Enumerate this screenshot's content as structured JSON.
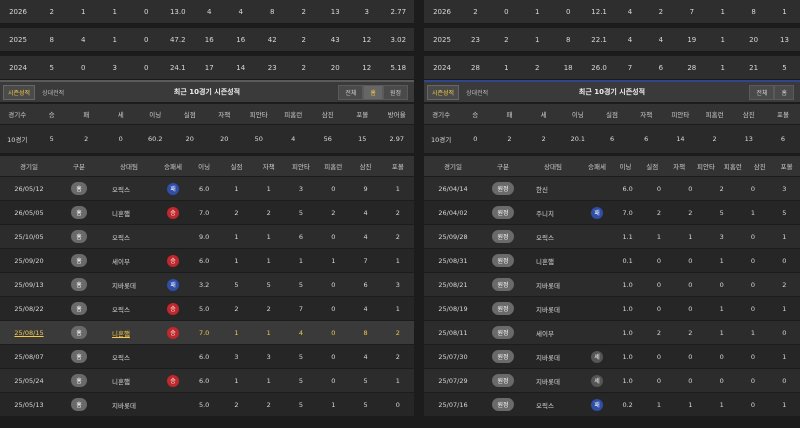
{
  "left": {
    "season_rows": [
      {
        "year": "2026",
        "vals": [
          "2",
          "1",
          "1",
          "0",
          "13.0",
          "4",
          "4",
          "8",
          "2",
          "13",
          "3",
          "2.77"
        ]
      },
      {
        "year": "2025",
        "vals": [
          "8",
          "4",
          "1",
          "0",
          "47.2",
          "16",
          "16",
          "42",
          "2",
          "43",
          "12",
          "3.02"
        ]
      },
      {
        "year": "2024",
        "vals": [
          "5",
          "0",
          "3",
          "0",
          "24.1",
          "17",
          "14",
          "23",
          "2",
          "20",
          "12",
          "5.18"
        ]
      }
    ],
    "tabs": [
      "시즌성적",
      "상대전적"
    ],
    "title": "최근 10경기 시즌성적",
    "filters": [
      "전체",
      "홈",
      "원정"
    ],
    "summary_headers": [
      "경기수",
      "승",
      "패",
      "세",
      "이닝",
      "실점",
      "자책",
      "피안타",
      "피홈런",
      "삼진",
      "포볼",
      "방어율"
    ],
    "summary_values": [
      "10경기",
      "5",
      "2",
      "0",
      "60.2",
      "20",
      "20",
      "50",
      "4",
      "56",
      "15",
      "2.97"
    ],
    "gamelog_headers": [
      "경기일",
      "구분",
      "상대팀",
      "승패세",
      "이닝",
      "실점",
      "자책",
      "피안타",
      "피홈런",
      "삼진",
      "포볼"
    ],
    "games": [
      {
        "date": "26/05/12",
        "ha": "홈",
        "opp": "오릭스",
        "dec": "패",
        "dec_type": "L",
        "nums": [
          "6.0",
          "1",
          "1",
          "3",
          "0",
          "9",
          "1"
        ]
      },
      {
        "date": "26/05/05",
        "ha": "홈",
        "opp": "니혼햄",
        "dec": "승",
        "dec_type": "W",
        "nums": [
          "7.0",
          "2",
          "2",
          "5",
          "2",
          "4",
          "2"
        ]
      },
      {
        "date": "25/10/05",
        "ha": "홈",
        "opp": "오릭스",
        "dec": "",
        "dec_type": "",
        "nums": [
          "9.0",
          "1",
          "1",
          "6",
          "0",
          "4",
          "2"
        ]
      },
      {
        "date": "25/09/20",
        "ha": "홈",
        "opp": "세이부",
        "dec": "승",
        "dec_type": "W",
        "nums": [
          "6.0",
          "1",
          "1",
          "1",
          "1",
          "7",
          "1"
        ]
      },
      {
        "date": "25/09/13",
        "ha": "홈",
        "opp": "지바롯데",
        "dec": "패",
        "dec_type": "L",
        "nums": [
          "3.2",
          "5",
          "5",
          "5",
          "0",
          "6",
          "3"
        ]
      },
      {
        "date": "25/08/22",
        "ha": "홈",
        "opp": "오릭스",
        "dec": "승",
        "dec_type": "W",
        "nums": [
          "5.0",
          "2",
          "2",
          "7",
          "0",
          "4",
          "1"
        ]
      },
      {
        "date": "25/08/15",
        "ha": "홈",
        "opp": "니혼햄",
        "dec": "승",
        "dec_type": "W",
        "nums": [
          "7.0",
          "1",
          "1",
          "4",
          "0",
          "8",
          "2"
        ],
        "hl": true
      },
      {
        "date": "25/08/07",
        "ha": "홈",
        "opp": "오릭스",
        "dec": "",
        "dec_type": "",
        "nums": [
          "6.0",
          "3",
          "3",
          "5",
          "0",
          "4",
          "2"
        ]
      },
      {
        "date": "25/05/24",
        "ha": "홈",
        "opp": "니혼햄",
        "dec": "승",
        "dec_type": "W",
        "nums": [
          "6.0",
          "1",
          "1",
          "5",
          "0",
          "5",
          "1"
        ]
      },
      {
        "date": "25/05/13",
        "ha": "홈",
        "opp": "지바롯데",
        "dec": "",
        "dec_type": "",
        "nums": [
          "5.0",
          "2",
          "2",
          "5",
          "1",
          "5",
          "0"
        ]
      }
    ]
  },
  "right": {
    "season_rows": [
      {
        "year": "2026",
        "vals": [
          "2",
          "0",
          "1",
          "0",
          "12.1",
          "4",
          "2",
          "7",
          "1",
          "8",
          "1"
        ]
      },
      {
        "year": "2025",
        "vals": [
          "23",
          "2",
          "1",
          "8",
          "22.1",
          "4",
          "4",
          "19",
          "1",
          "20",
          "13"
        ]
      },
      {
        "year": "2024",
        "vals": [
          "28",
          "1",
          "2",
          "18",
          "26.0",
          "7",
          "6",
          "28",
          "1",
          "21",
          "5"
        ]
      }
    ],
    "tabs": [
      "시즌성적",
      "상대전적"
    ],
    "title": "최근 10경기 시즌성적",
    "filters": [
      "전체",
      "홈"
    ],
    "summary_headers": [
      "경기수",
      "승",
      "패",
      "세",
      "이닝",
      "실점",
      "자책",
      "피안타",
      "피홈런",
      "삼진",
      "포볼"
    ],
    "summary_values": [
      "10경기",
      "0",
      "2",
      "2",
      "20.1",
      "6",
      "6",
      "14",
      "2",
      "13",
      "6"
    ],
    "gamelog_headers": [
      "경기일",
      "구분",
      "상대팀",
      "승패세",
      "이닝",
      "실점",
      "자책",
      "피안타",
      "피홈런",
      "삼진",
      "포볼"
    ],
    "games": [
      {
        "date": "26/04/14",
        "ha": "원정",
        "opp": "한신",
        "dec": "",
        "dec_type": "",
        "nums": [
          "6.0",
          "0",
          "0",
          "2",
          "0",
          "3"
        ]
      },
      {
        "date": "26/04/02",
        "ha": "원정",
        "opp": "주니치",
        "dec": "패",
        "dec_type": "L",
        "nums": [
          "7.0",
          "2",
          "2",
          "5",
          "1",
          "5"
        ]
      },
      {
        "date": "25/09/28",
        "ha": "원정",
        "opp": "오릭스",
        "dec": "",
        "dec_type": "",
        "nums": [
          "1.1",
          "1",
          "1",
          "3",
          "0",
          "1"
        ]
      },
      {
        "date": "25/08/31",
        "ha": "원정",
        "opp": "니혼햄",
        "dec": "",
        "dec_type": "",
        "nums": [
          "0.1",
          "0",
          "0",
          "1",
          "0",
          "0"
        ]
      },
      {
        "date": "25/08/21",
        "ha": "원정",
        "opp": "지바롯데",
        "dec": "",
        "dec_type": "",
        "nums": [
          "1.0",
          "0",
          "0",
          "0",
          "0",
          "2"
        ]
      },
      {
        "date": "25/08/19",
        "ha": "원정",
        "opp": "지바롯데",
        "dec": "",
        "dec_type": "",
        "nums": [
          "1.0",
          "0",
          "0",
          "1",
          "0",
          "1"
        ]
      },
      {
        "date": "25/08/11",
        "ha": "원정",
        "opp": "세이부",
        "dec": "",
        "dec_type": "",
        "nums": [
          "1.0",
          "2",
          "2",
          "1",
          "1",
          "0"
        ]
      },
      {
        "date": "25/07/30",
        "ha": "원정",
        "opp": "지바롯데",
        "dec": "세",
        "dec_type": "H",
        "nums": [
          "1.0",
          "0",
          "0",
          "0",
          "0",
          "1"
        ]
      },
      {
        "date": "25/07/29",
        "ha": "원정",
        "opp": "지바롯데",
        "dec": "세",
        "dec_type": "H",
        "nums": [
          "1.0",
          "0",
          "0",
          "0",
          "0",
          "0"
        ]
      },
      {
        "date": "25/07/16",
        "ha": "원정",
        "opp": "오릭스",
        "dec": "패",
        "dec_type": "L",
        "nums": [
          "0.2",
          "1",
          "1",
          "1",
          "0",
          "1"
        ]
      }
    ]
  }
}
